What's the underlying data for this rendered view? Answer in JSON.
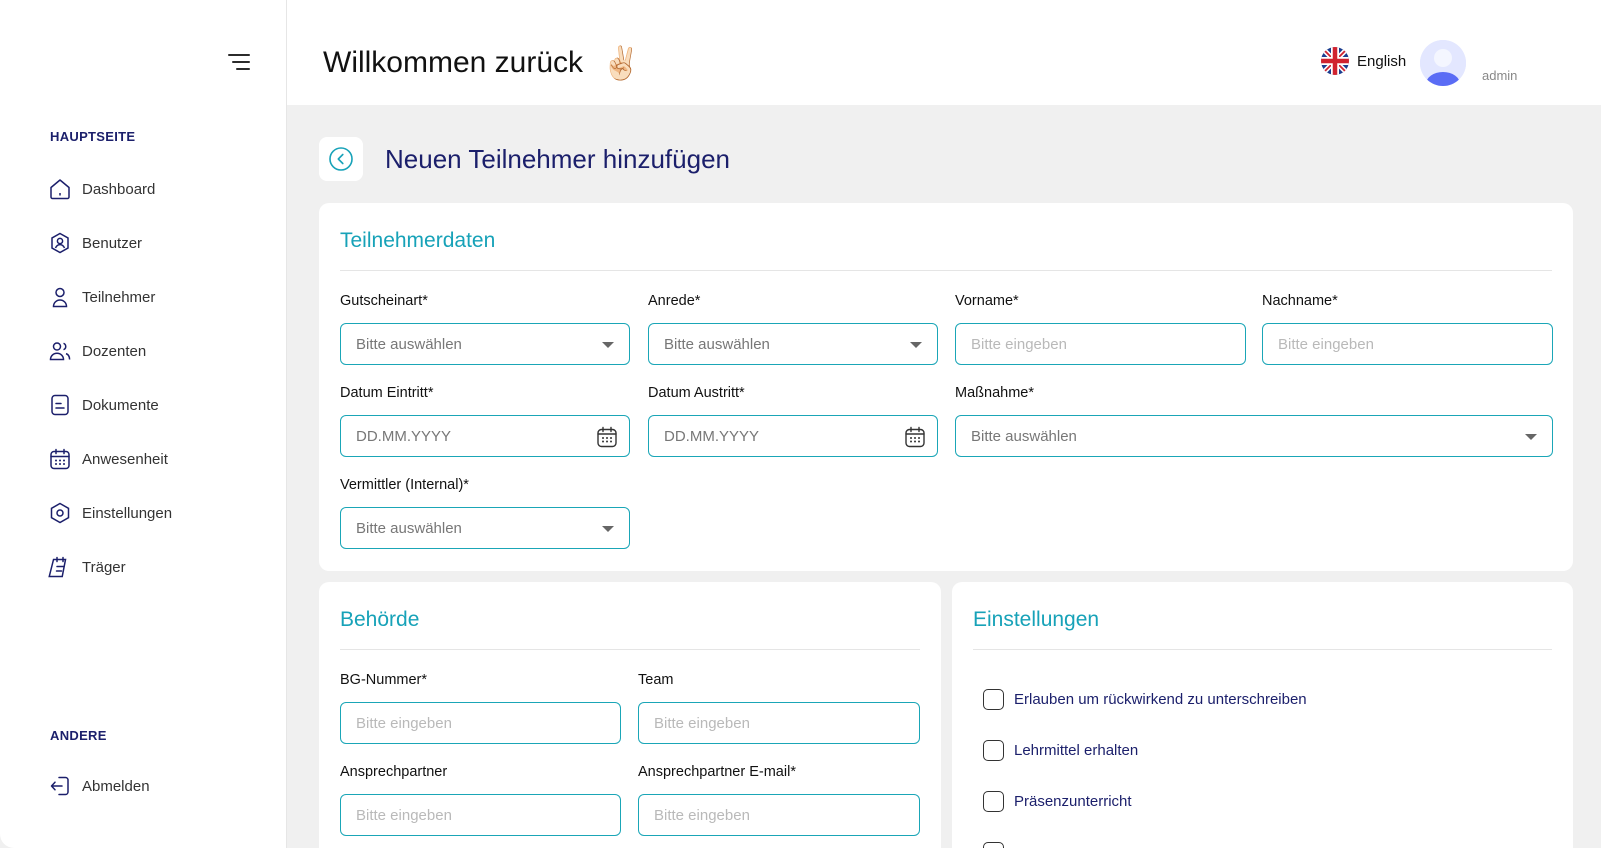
{
  "header": {
    "welcome": "Willkommen zurück",
    "wave_emoji": "✌🏻",
    "language": "English",
    "user_name": "",
    "user_role": "admin"
  },
  "sidebar": {
    "main_section": "HAUPTSEITE",
    "items": [
      {
        "label": "Dashboard",
        "icon": "home-icon"
      },
      {
        "label": "Benutzer",
        "icon": "user-badge-icon"
      },
      {
        "label": "Teilnehmer",
        "icon": "person-icon"
      },
      {
        "label": "Dozenten",
        "icon": "users-icon"
      },
      {
        "label": "Dokumente",
        "icon": "document-icon"
      },
      {
        "label": "Anwesenheit",
        "icon": "calendar-icon"
      },
      {
        "label": "Einstellungen",
        "icon": "settings-icon"
      },
      {
        "label": "Träger",
        "icon": "clipboard-icon"
      }
    ],
    "other_section": "ANDERE",
    "logout": {
      "label": "Abmelden",
      "icon": "logout-icon"
    }
  },
  "page": {
    "title": "Neuen Teilnehmer hinzufügen"
  },
  "participant": {
    "title": "Teilnehmerdaten",
    "gutscheinart": {
      "label": "Gutscheinart*",
      "placeholder": "Bitte auswählen"
    },
    "anrede": {
      "label": "Anrede*",
      "placeholder": "Bitte auswählen"
    },
    "vorname": {
      "label": "Vorname*",
      "placeholder": "Bitte eingeben"
    },
    "nachname": {
      "label": "Nachname*",
      "placeholder": "Bitte eingeben"
    },
    "datum_eintritt": {
      "label": "Datum Eintritt*",
      "placeholder": "DD.MM.YYYY"
    },
    "datum_austritt": {
      "label": "Datum Austritt*",
      "placeholder": "DD.MM.YYYY"
    },
    "massnahme": {
      "label": "Maßnahme*",
      "placeholder": "Bitte auswählen"
    },
    "vermittler": {
      "label": "Vermittler (Internal)*",
      "placeholder": "Bitte auswählen"
    }
  },
  "authority": {
    "title": "Behörde",
    "bg_nummer": {
      "label": "BG-Nummer*",
      "placeholder": "Bitte eingeben"
    },
    "team": {
      "label": "Team",
      "placeholder": "Bitte eingeben"
    },
    "ansprechpartner": {
      "label": "Ansprechpartner",
      "placeholder": "Bitte eingeben"
    },
    "ansprechpartner_email": {
      "label": "Ansprechpartner E-mail*",
      "placeholder": "Bitte eingeben"
    }
  },
  "settings": {
    "title": "Einstellungen",
    "options": [
      "Erlauben um rückwirkend zu unterschreiben",
      "Lehrmittel erhalten",
      "Präsenzunterricht"
    ]
  },
  "colors": {
    "accent": "#17a2b8",
    "navy": "#1b1f6b",
    "background": "#f0f0f0"
  }
}
